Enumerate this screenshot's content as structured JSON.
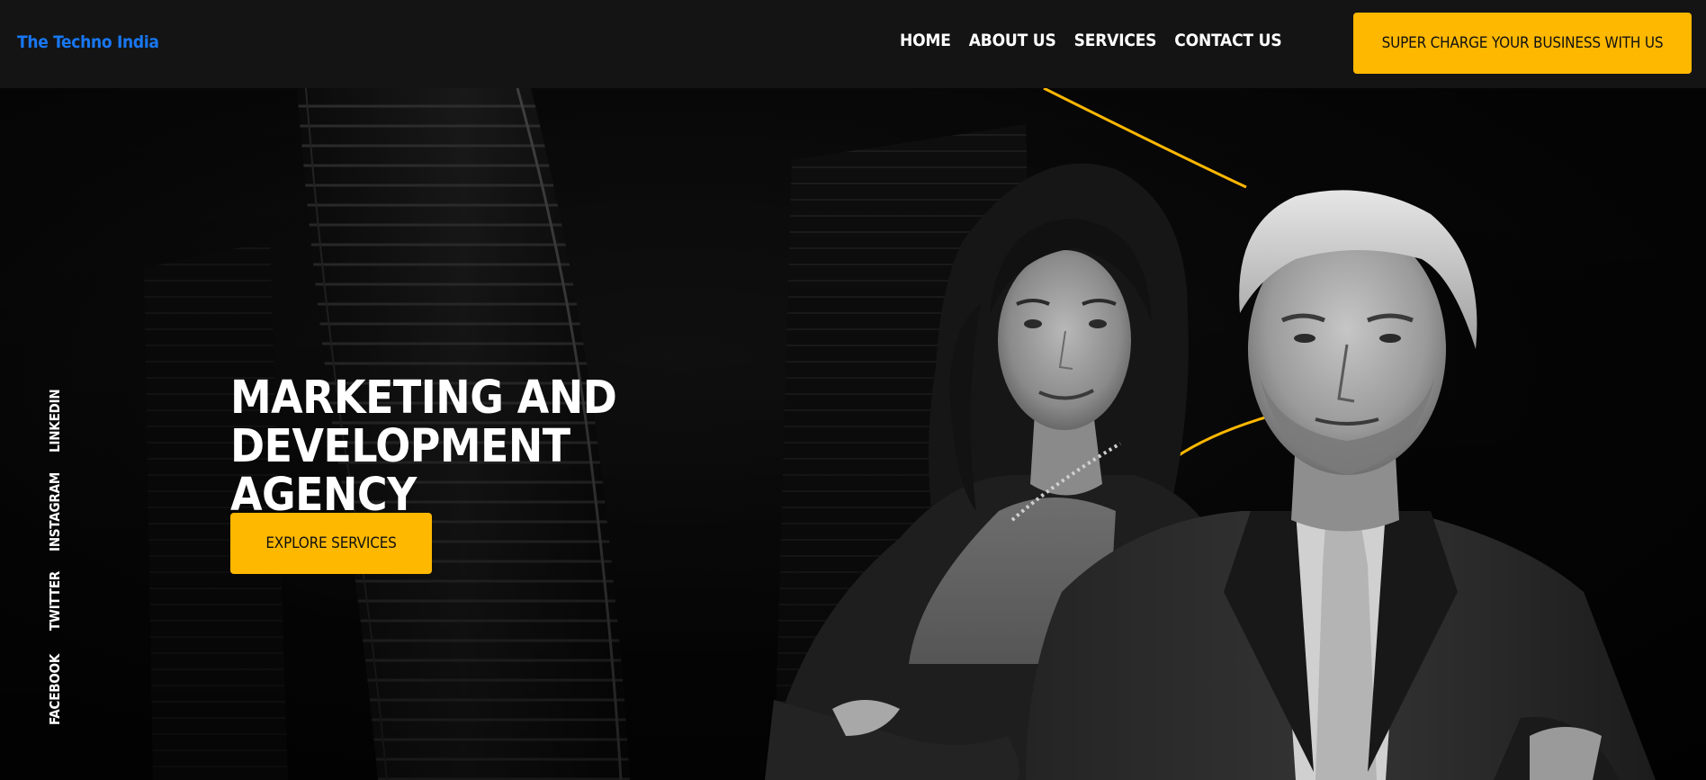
{
  "header": {
    "brand": "The Techno India",
    "nav": [
      {
        "label": "HOME"
      },
      {
        "label": "ABOUT US"
      },
      {
        "label": "SERVICES"
      },
      {
        "label": "CONTACT US"
      }
    ],
    "cta_label": "SUPER CHARGE YOUR BUSINESS WITH US"
  },
  "hero": {
    "headline_line1": "MARKETING AND DEVELOPMENT",
    "headline_line2": "AGENCY",
    "cta_label": "EXPLORE SERVICES",
    "social": [
      {
        "label": "LINKEDIN"
      },
      {
        "label": "INSTAGRAM"
      },
      {
        "label": "TWITTER"
      },
      {
        "label": "FACEBOOK"
      }
    ]
  },
  "colors": {
    "accent": "#ffb800",
    "brand": "#1877f2",
    "navbar_bg": "#141414",
    "hero_bg": "#050505"
  }
}
